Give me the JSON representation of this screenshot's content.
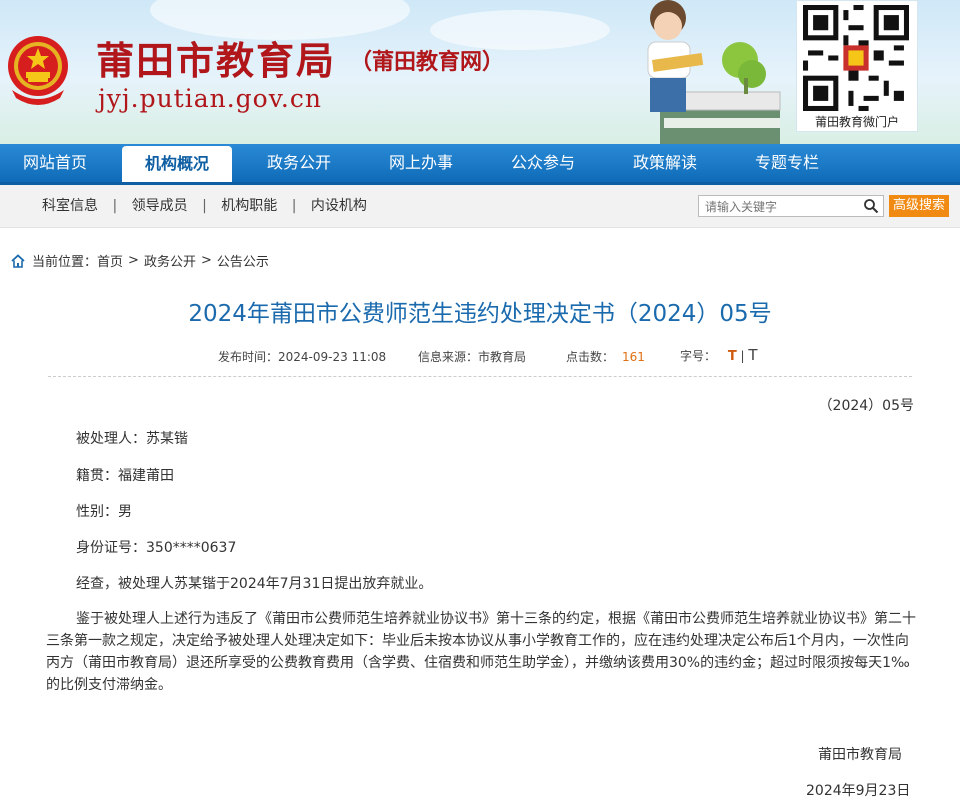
{
  "header": {
    "title": "莆田市教育局",
    "subtitle": "（莆田教育网）",
    "domain": "jyj.putian.gov.cn",
    "qr_caption": "莆田教育微门户"
  },
  "nav": {
    "items": [
      "网站首页",
      "机构概况",
      "政务公开",
      "网上办事",
      "公众参与",
      "政策解读",
      "专题专栏"
    ],
    "active_index": 1
  },
  "subnav": {
    "items": [
      "科室信息",
      "领导成员",
      "机构职能",
      "内设机构"
    ],
    "separator": "|",
    "search_placeholder": "请输入关键字",
    "advanced_search": "高级搜索"
  },
  "breadcrumb": {
    "label": "当前位置：",
    "items": [
      "首页",
      "政务公开",
      "公告公示"
    ],
    "separator": ">"
  },
  "article": {
    "title": "2024年莆田市公费师范生违约处理决定书（2024）05号",
    "publish_label": "发布时间：",
    "publish_time": "2024-09-23 11:08",
    "source_label": "信息来源：",
    "source": "市教育局",
    "hits_label": "点击数：",
    "hits": "161",
    "font_label": "字号：",
    "font_big": "T",
    "font_sep": "|",
    "font_small": "T",
    "doc_number": "（2024）05号",
    "fields": [
      "被处理人：苏某锴",
      "籍贯：福建莆田",
      "性别：男",
      "身份证号：350****0637",
      "经查，被处理人苏某锴于2024年7月31日提出放弃就业。"
    ],
    "decision": "鉴于被处理人上述行为违反了《莆田市公费师范生培养就业协议书》第十三条的约定，根据《莆田市公费师范生培养就业协议书》第二十三条第一款之规定，决定给予被处理人处理决定如下：毕业后未按本协议从事小学教育工作的，应在违约处理决定公布后1个月内，一次性向丙方（莆田市教育局）退还所享受的公费教育费用（含学费、住宿费和师范生助学金），并缴纳该费用30%的违约金；超过时限须按每天1‰的比例支付滞纳金。",
    "signature": "莆田市教育局",
    "date": "2024年9月23日"
  },
  "colors": {
    "nav_blue": "#1676c6",
    "title_blue": "#1a6aad",
    "brand_red": "#b0161a",
    "accent_orange": "#f08a12"
  }
}
